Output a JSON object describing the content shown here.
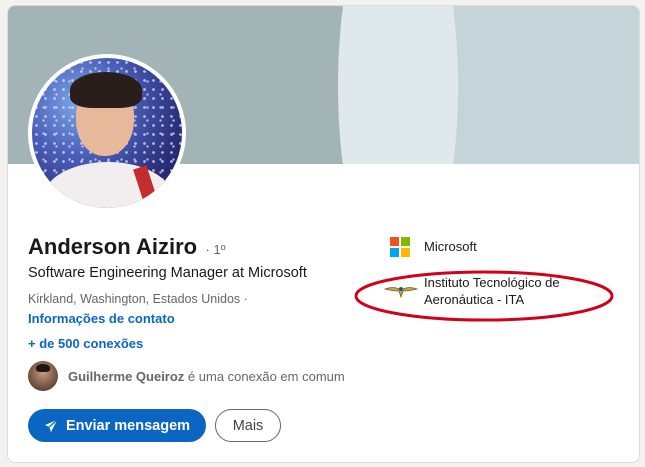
{
  "profile": {
    "name": "Anderson Aiziro",
    "degree": "· 1º",
    "headline": "Software Engineering Manager at Microsoft",
    "location": "Kirkland, Washington, Estados Unidos ·",
    "contact_link": "Informações de contato",
    "connections": "+ de 500 conexões"
  },
  "mutual": {
    "name": "Guilherme Queiroz",
    "suffix": " é uma conexão em comum"
  },
  "actions": {
    "message_label": "Enviar mensagem",
    "more_label": "Mais"
  },
  "experience": [
    {
      "label": "Microsoft",
      "icon": "microsoft-logo-icon"
    },
    {
      "label": "Instituto Tecnológico de Aeronáutica - ITA",
      "icon": "ita-logo-icon"
    }
  ],
  "colors": {
    "accent": "#0a66c2",
    "annotation": "#d0021b",
    "ms_red": "#f25022",
    "ms_green": "#7fba00",
    "ms_blue": "#00a4ef",
    "ms_yellow": "#ffb900"
  }
}
